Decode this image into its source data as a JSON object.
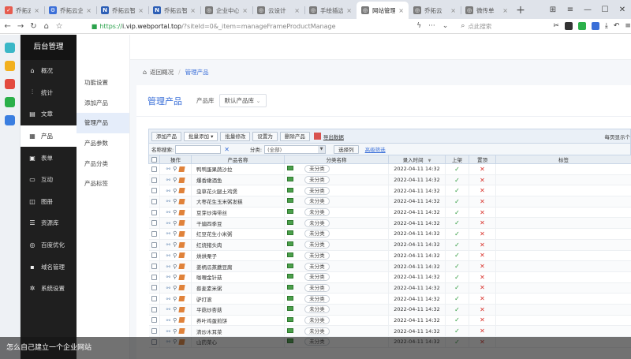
{
  "browser": {
    "tabs": [
      {
        "label": "乔拓云_员",
        "color": "#e65c4f",
        "glyph": "✓",
        "width": 56
      },
      {
        "label": "乔拓云企业",
        "color": "#3b6fd8",
        "glyph": "⚙",
        "width": 66
      },
      {
        "label": "乔拓云智能",
        "color": "#2d5fb6",
        "glyph": "N",
        "width": 66
      },
      {
        "label": "乔拓云智能",
        "color": "#2d5fb6",
        "glyph": "N",
        "width": 66
      },
      {
        "label": "企业中心",
        "color": "#7a7a7a",
        "glyph": "◎",
        "width": 66
      },
      {
        "label": "云设计",
        "color": "#7a7a7a",
        "glyph": "◎",
        "width": 66
      },
      {
        "label": "手绘插边",
        "color": "#7a7a7a",
        "glyph": "◎",
        "width": 66
      },
      {
        "label": "网站管理",
        "color": "#7a7a7a",
        "glyph": "◎",
        "width": 66,
        "active": true
      },
      {
        "label": "乔拓云",
        "color": "#7a7a7a",
        "glyph": "◎",
        "width": 66
      },
      {
        "label": "微传单",
        "color": "#7a7a7a",
        "glyph": "◎",
        "width": 66
      }
    ],
    "url": {
      "scheme": "https://",
      "host": "i.vip.webportal.top",
      "path": "/?siteId=0&_item=manageFrameProductManage"
    },
    "search_placeholder": "点此搜索"
  },
  "sidebar": {
    "title": "后台管理",
    "items": [
      {
        "label": "概况",
        "icon": "home-icon",
        "glyph": "⌂"
      },
      {
        "label": "统计",
        "icon": "chart-icon",
        "glyph": "⫶"
      },
      {
        "label": "文章",
        "icon": "article-icon",
        "glyph": "▤"
      },
      {
        "label": "产品",
        "icon": "grid-icon",
        "glyph": "▦",
        "active": true
      },
      {
        "label": "表单",
        "icon": "form-icon",
        "glyph": "▣"
      },
      {
        "label": "互动",
        "icon": "chat-icon",
        "glyph": "▭"
      },
      {
        "label": "图册",
        "icon": "gallery-icon",
        "glyph": "◫"
      },
      {
        "label": "资源库",
        "icon": "library-icon",
        "glyph": "☰"
      },
      {
        "label": "百度优化",
        "icon": "seo-icon",
        "glyph": "◎"
      },
      {
        "label": "域名管理",
        "icon": "domain-icon",
        "glyph": "▪"
      },
      {
        "label": "系统设置",
        "icon": "gear-icon",
        "glyph": "✲"
      }
    ]
  },
  "subnav": {
    "items": [
      {
        "label": "功能设置"
      },
      {
        "label": "添加产品"
      },
      {
        "label": "管理产品",
        "active": true
      },
      {
        "label": "产品参数"
      },
      {
        "label": "产品分类"
      },
      {
        "label": "产品标签"
      }
    ]
  },
  "breadcrumb": {
    "back": "返回概况",
    "current": "管理产品"
  },
  "panel": {
    "title": "管理产品",
    "library_label": "产品库",
    "library_value": "默认产品库"
  },
  "toolbar": {
    "add": "添加产品",
    "batch_add": "批量添加",
    "batch_edit": "批量修改",
    "set_as": "设置为",
    "delete": "删除产品",
    "export": "导出数据",
    "per_page": "每页显示个"
  },
  "filter": {
    "name_label": "名称搜索:",
    "category_label": "分类:",
    "category_value": "(全部)",
    "select_columns": "选择列",
    "advanced": "高级筛选"
  },
  "columns": {
    "ops": "操作",
    "name": "产品名称",
    "category": "分类名称",
    "time": "录入时间",
    "online": "上架",
    "top": "置顶",
    "tags": "标签"
  },
  "rows": [
    {
      "name": "鸭鸭蛋果蔬沙拉",
      "category": "未分类",
      "time": "2022-04-11 14:32",
      "online": true,
      "top": false
    },
    {
      "name": "爆香嫩酒鱼",
      "category": "未分类",
      "time": "2022-04-11 14:32",
      "online": true,
      "top": false
    },
    {
      "name": "虫草花火腿土鸡煲",
      "category": "未分类",
      "time": "2022-04-11 14:32",
      "online": true,
      "top": false
    },
    {
      "name": "大枣花生玉米粥发糕",
      "category": "未分类",
      "time": "2022-04-11 14:32",
      "online": true,
      "top": false
    },
    {
      "name": "豆芽炒海带丝",
      "category": "未分类",
      "time": "2022-04-11 14:32",
      "online": true,
      "top": false
    },
    {
      "name": "干煸四季豆",
      "category": "未分类",
      "time": "2022-04-11 14:32",
      "online": true,
      "top": false
    },
    {
      "name": "红豆花生小米粥",
      "category": "未分类",
      "time": "2022-04-11 14:32",
      "online": true,
      "top": false
    },
    {
      "name": "红烧猪头肉",
      "category": "未分类",
      "time": "2022-04-11 14:32",
      "online": true,
      "top": false
    },
    {
      "name": "烘烘栗子",
      "category": "未分类",
      "time": "2022-04-11 14:32",
      "online": true,
      "top": false
    },
    {
      "name": "姜柄瓜蒸蘑豆腐",
      "category": "未分类",
      "time": "2022-04-11 14:32",
      "online": true,
      "top": false
    },
    {
      "name": "咖喱金针菇",
      "category": "未分类",
      "time": "2022-04-11 14:32",
      "online": true,
      "top": false
    },
    {
      "name": "蔡麦素米粥",
      "category": "未分类",
      "time": "2022-04-11 14:32",
      "online": true,
      "top": false
    },
    {
      "name": "驴打滚",
      "category": "未分类",
      "time": "2022-04-11 14:32",
      "online": true,
      "top": false
    },
    {
      "name": "平菇炒杏菇",
      "category": "未分类",
      "time": "2022-04-11 14:32",
      "online": true,
      "top": false
    },
    {
      "name": "养叶鸡蛋煎饼",
      "category": "未分类",
      "time": "2022-04-11 14:32",
      "online": true,
      "top": false
    },
    {
      "name": "清炒木耳菜",
      "category": "未分类",
      "time": "2022-04-11 14:32",
      "online": true,
      "top": false
    },
    {
      "name": "山药菜心",
      "category": "未分类",
      "time": "2022-04-11 14:32",
      "online": true,
      "top": false
    }
  ],
  "caption": "怎么自己建立一个企业网站"
}
